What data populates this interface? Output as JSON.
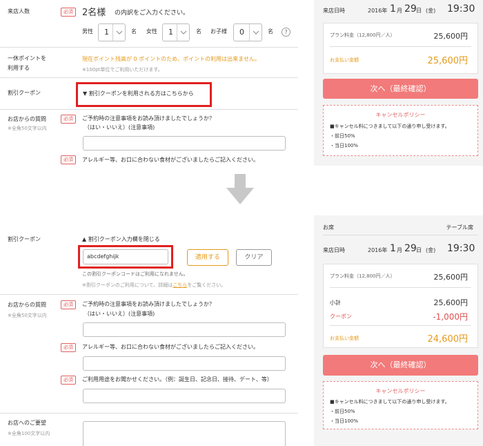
{
  "top": {
    "guests": {
      "label": "来店人数",
      "required": "必須",
      "count": "2名様",
      "prompt": "の内訳をご入力ください。",
      "male_label": "男性",
      "male_value": "1",
      "female_label": "女性",
      "female_value": "1",
      "child_label": "お子様",
      "child_value": "0",
      "unit": "名",
      "help_icon": "?"
    },
    "points": {
      "label": "一休ポイントを\n利用する",
      "message": "現在ポイント残高が 0 ポイントのため、ポイントの利用は出来ません。",
      "note": "※100pt単位でご利用いただけます。"
    },
    "coupon": {
      "label": "割引クーポン",
      "toggle": "▼ 割引クーポンを利用される方はこちらから"
    },
    "question": {
      "label": "お店からの質問",
      "sublabel": "※全角50文字以内",
      "required": "必須",
      "q1": "ご予約時の注意事項をお読み頂けましたでしょうか？",
      "q1b": "（はい・いいえ）(注意事項)",
      "required2": "必須",
      "q2": "アレルギー等、お口に合わない食材がございましたらご記入ください。"
    },
    "summary": {
      "date_label": "来店日時",
      "year": "2016年",
      "month": "1",
      "month_unit": "月",
      "day": "29",
      "day_unit": "日",
      "weekday": "(金)",
      "time": "19:30",
      "plan_label": "プラン料金（12,800円／人）",
      "plan_amount": "25,600円",
      "pay_label": "お支払い金額",
      "pay_amount": "25,600円",
      "next_button": "次へ（最終確認）",
      "cancel_title": "キャンセルポリシー",
      "cancel_line1": "■キャンセル料につきまして以下の通り申し受けます。",
      "cancel_line2": "・前日50%",
      "cancel_line3": "・当日100%"
    }
  },
  "bottom": {
    "coupon": {
      "label": "割引クーポン",
      "toggle": "▲ 割引クーポン入力欄を閉じる",
      "input_value": "abcdefghijk",
      "apply_button": "適用する",
      "clear_button": "クリア",
      "error": "この割引クーポンコードはご利用になれません。",
      "note_prefix": "※割引クーポンのご利用について、詳細は",
      "note_link": "こちら",
      "note_suffix": "をご覧ください。"
    },
    "question": {
      "label": "お店からの質問",
      "sublabel": "※全角50文字以内",
      "required": "必須",
      "q1": "ご予約時の注意事項をお読み頂けましたでしょうか？",
      "q1b": "（はい・いいえ）(注意事項)",
      "required2": "必須",
      "q2": "アレルギー等、お口に合わない食材がございましたらご記入ください。",
      "required3": "必須",
      "q3": "ご利用用途をお聞かせください。（例：誕生日、記念日、接待、デート、等）"
    },
    "request": {
      "label": "お店へのご要望",
      "sublabel": "※全角100文字以内"
    },
    "summary": {
      "seat_label": "お席",
      "seat_value": "テーブル席",
      "date_label": "来店日時",
      "year": "2016年",
      "month": "1",
      "month_unit": "月",
      "day": "29",
      "day_unit": "日",
      "weekday": "(金)",
      "time": "19:30",
      "plan_label": "プラン料金（12,800円／人）",
      "plan_amount": "25,600円",
      "subtotal_label": "小計",
      "subtotal_amount": "25,600円",
      "coupon_label": "クーポン",
      "coupon_amount": "-1,000円",
      "pay_label": "お支払い金額",
      "pay_amount": "24,600円",
      "next_button": "次へ（最終確認）",
      "cancel_title": "キャンセルポリシー",
      "cancel_line1": "■キャンセル料につきまして以下の通り申し受けます。",
      "cancel_line2": "・前日50%",
      "cancel_line3": "・当日100%"
    }
  },
  "colors": {
    "accent_red": "#f27a7a",
    "highlight": "#e02020",
    "orange": "#e59a1c",
    "arrow": "#c8c8c8"
  }
}
